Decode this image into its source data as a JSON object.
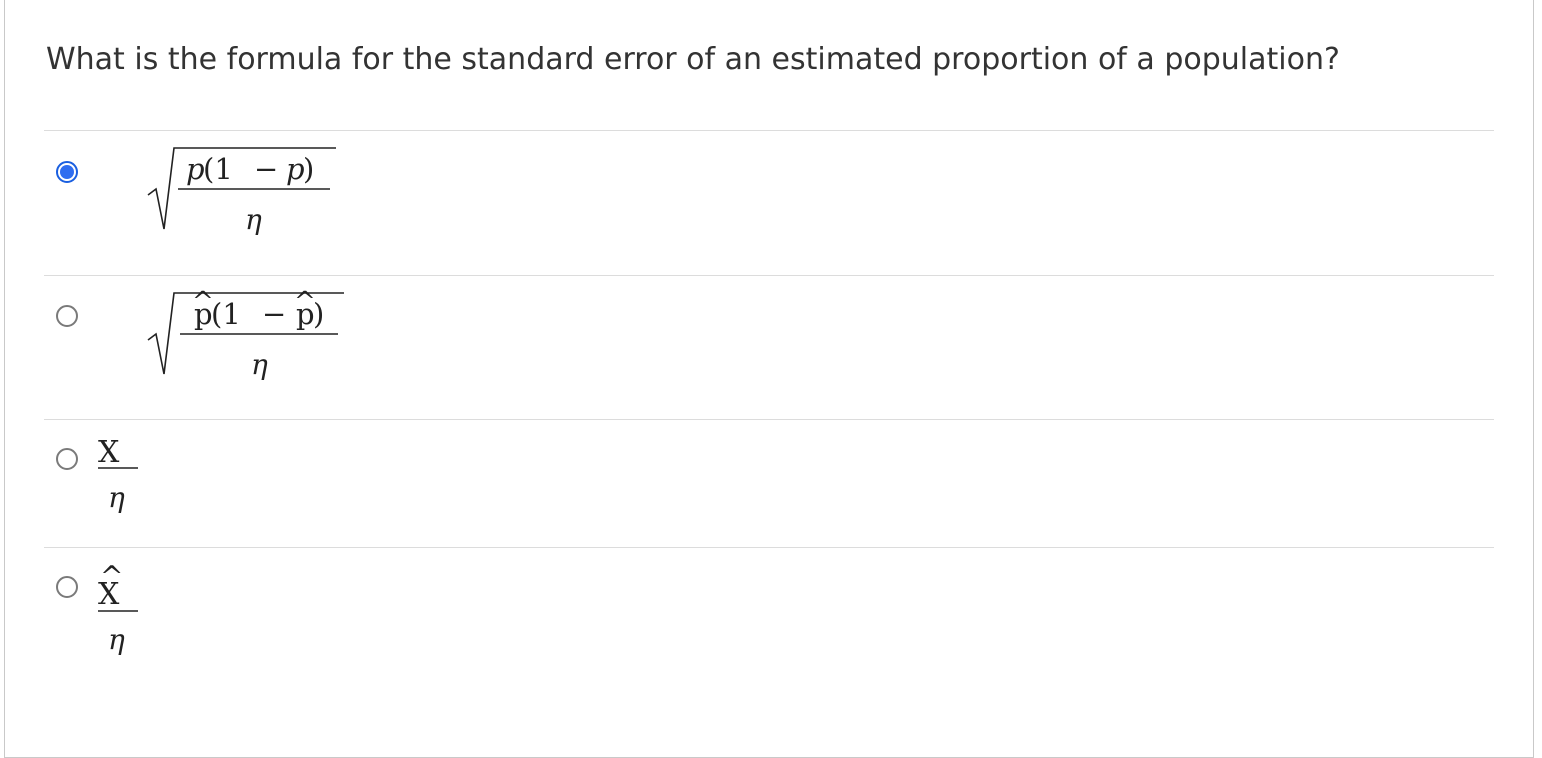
{
  "question": {
    "text": "What is the formula for the standard error of an estimated proportion of a population?"
  },
  "options": [
    {
      "selected": true,
      "formula": {
        "numerator": {
          "a": "p",
          "b": "(1",
          "c": "−",
          "d": "p",
          "e": ")"
        },
        "denominator": "η"
      }
    },
    {
      "selected": false,
      "formula": {
        "numerator": {
          "a": "p",
          "hat_a": "^",
          "b": "(1",
          "c": "−",
          "d": "p",
          "hat_d": "^",
          "e": ")"
        },
        "denominator": "η"
      }
    },
    {
      "selected": false,
      "formula": {
        "numerator": "X",
        "denominator": "η"
      }
    },
    {
      "selected": false,
      "formula": {
        "numerator": "X",
        "hat": "^",
        "denominator": "η"
      }
    }
  ],
  "colors": {
    "accent": "#2f6df0",
    "divider": "#dcdcdc",
    "text": "#333333"
  }
}
